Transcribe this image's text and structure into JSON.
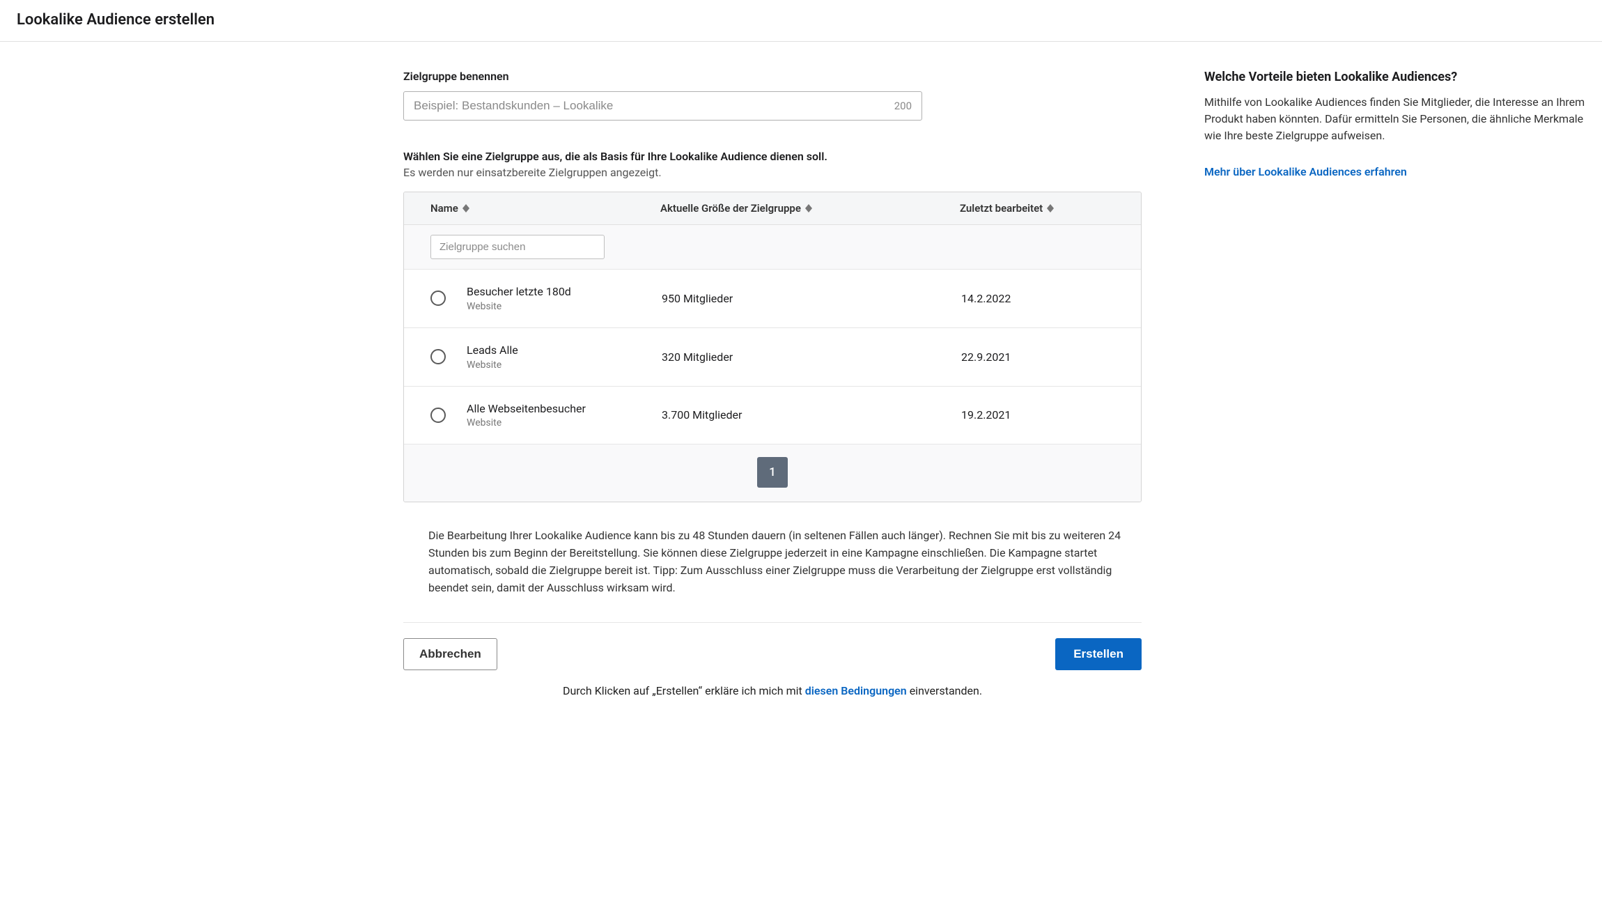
{
  "header": {
    "title": "Lookalike Audience erstellen"
  },
  "form": {
    "name_label": "Zielgruppe benennen",
    "name_placeholder": "Beispiel: Bestandskunden – Lookalike",
    "name_count": "200"
  },
  "selection": {
    "heading": "Wählen Sie eine Zielgruppe aus, die als Basis für Ihre Lookalike Audience dienen soll.",
    "subheading": "Es werden nur einsatzbereite Zielgruppen angezeigt."
  },
  "table": {
    "columns": {
      "name": "Name",
      "size": "Aktuelle Größe der Zielgruppe",
      "date": "Zuletzt bearbeitet"
    },
    "search_placeholder": "Zielgruppe suchen",
    "rows": [
      {
        "name": "Besucher letzte 180d",
        "type": "Website",
        "size": "950 Mitglieder",
        "date": "14.2.2022"
      },
      {
        "name": "Leads Alle",
        "type": "Website",
        "size": "320 Mitglieder",
        "date": "22.9.2021"
      },
      {
        "name": "Alle Webseitenbesucher",
        "type": "Website",
        "size": "3.700 Mitglieder",
        "date": "19.2.2021"
      }
    ],
    "pagination": {
      "current": "1"
    }
  },
  "info": {
    "text": "Die Bearbeitung Ihrer Lookalike Audience kann bis zu 48 Stunden dauern (in seltenen Fällen auch länger). Rechnen Sie mit bis zu weiteren 24 Stunden bis zum Beginn der Bereitstellung. Sie können diese Zielgruppe jederzeit in eine Kampagne einschließen. Die Kampagne startet automatisch, sobald die Zielgruppe bereit ist. Tipp: Zum Ausschluss einer Zielgruppe muss die Verarbeitung der Zielgruppe erst vollständig beendet sein, damit der Ausschluss wirksam wird."
  },
  "actions": {
    "cancel": "Abbrechen",
    "create": "Erstellen"
  },
  "terms": {
    "pre": "Durch Klicken auf „Erstellen“ erkläre ich mich mit ",
    "link": "diesen Bedingungen",
    "post": " einverstanden."
  },
  "sidebar": {
    "title": "Welche Vorteile bieten Lookalike Audiences?",
    "text": "Mithilfe von Lookalike Audiences finden Sie Mitglieder, die Interesse an Ihrem Produkt haben könnten. Dafür ermitteln Sie Personen, die ähnliche Merkmale wie Ihre beste Zielgruppe aufweisen.",
    "link": "Mehr über Lookalike Audiences erfahren"
  }
}
